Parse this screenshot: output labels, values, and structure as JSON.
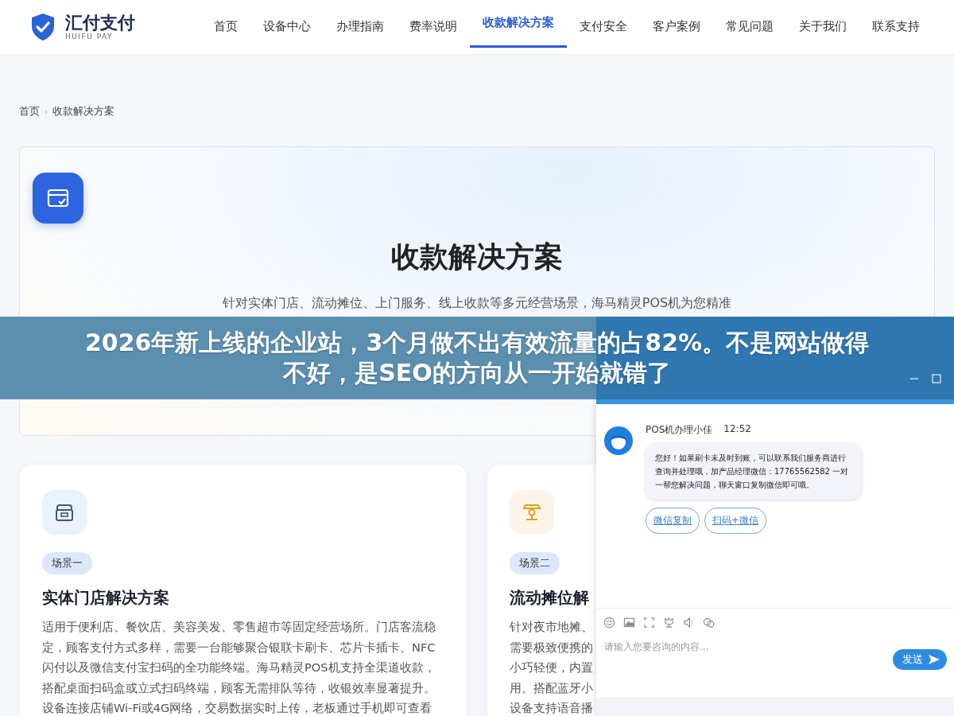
{
  "brand": {
    "name": "汇付支付",
    "tagline": "HUIFU PAY"
  },
  "nav": [
    {
      "label": "首页",
      "selected": false
    },
    {
      "label": "设备中心",
      "selected": false
    },
    {
      "label": "办理指南",
      "selected": false
    },
    {
      "label": "费率说明",
      "selected": false
    },
    {
      "label": "收款解决方案",
      "selected": true
    },
    {
      "label": "支付安全",
      "selected": false
    },
    {
      "label": "客户案例",
      "selected": false
    },
    {
      "label": "常见问题",
      "selected": false
    },
    {
      "label": "关于我们",
      "selected": false
    },
    {
      "label": "联系支持",
      "selected": false
    }
  ],
  "breadcrumb": {
    "separator": "›",
    "items": [
      "首页",
      "收款解决方案"
    ]
  },
  "hero": {
    "title": "收款解决方案",
    "lines": [
      "针对实体门店、流动摊位、上门服务、线上收款等多元经营场景，海马精灵POS机为您精准"
    ]
  },
  "cards": [
    {
      "kind": "store",
      "tag": "场景一",
      "title": "实体门店解决方案",
      "lines": [
        "适用于便利店、餐饮店、美容美发、零售超市等固定经营场所。门店客流稳",
        "定，顾客支付方式多样，需要一台能够聚合银联卡刷卡、芯片卡插卡、NFC",
        "闪付以及微信支付宝扫码的全功能终端。海马精灵POS机支持全渠道收款，",
        "搭配桌面扫码盒或立式扫码终端，顾客无需排队等待，收银效率显著提升。",
        "设备连接店铺Wi-Fi或4G网络，交易数据实时上传，老板通过手机即可查看"
      ]
    },
    {
      "kind": "stall",
      "tag": "场景二",
      "title": "流动摊位解",
      "lines": [
        "针对夜市地摊、",
        "需要极致便携的",
        "小巧轻便，内置",
        "用。搭配蓝牙小",
        "设备支持语音播"
      ]
    }
  ],
  "chat": {
    "agent": "POS机办理小佳",
    "time": "12:52",
    "message": "您好！如果刷卡未及时到账，可以联系我们服务商进行查询并处理哦，加产品经理微信：17765562582 一对一帮您解决问题，聊天窗口复制微信即可哦。",
    "actions": [
      "微信复制",
      "扫码+微信"
    ],
    "placeholder": "请输入您要咨询的内容...",
    "send": "发送"
  },
  "banner": {
    "lines": [
      "2026年新上线的企业站，3个月做不出有效流量的占82%。不是网站做得",
      "不好，是SEO的方向从一开始就错了"
    ]
  }
}
